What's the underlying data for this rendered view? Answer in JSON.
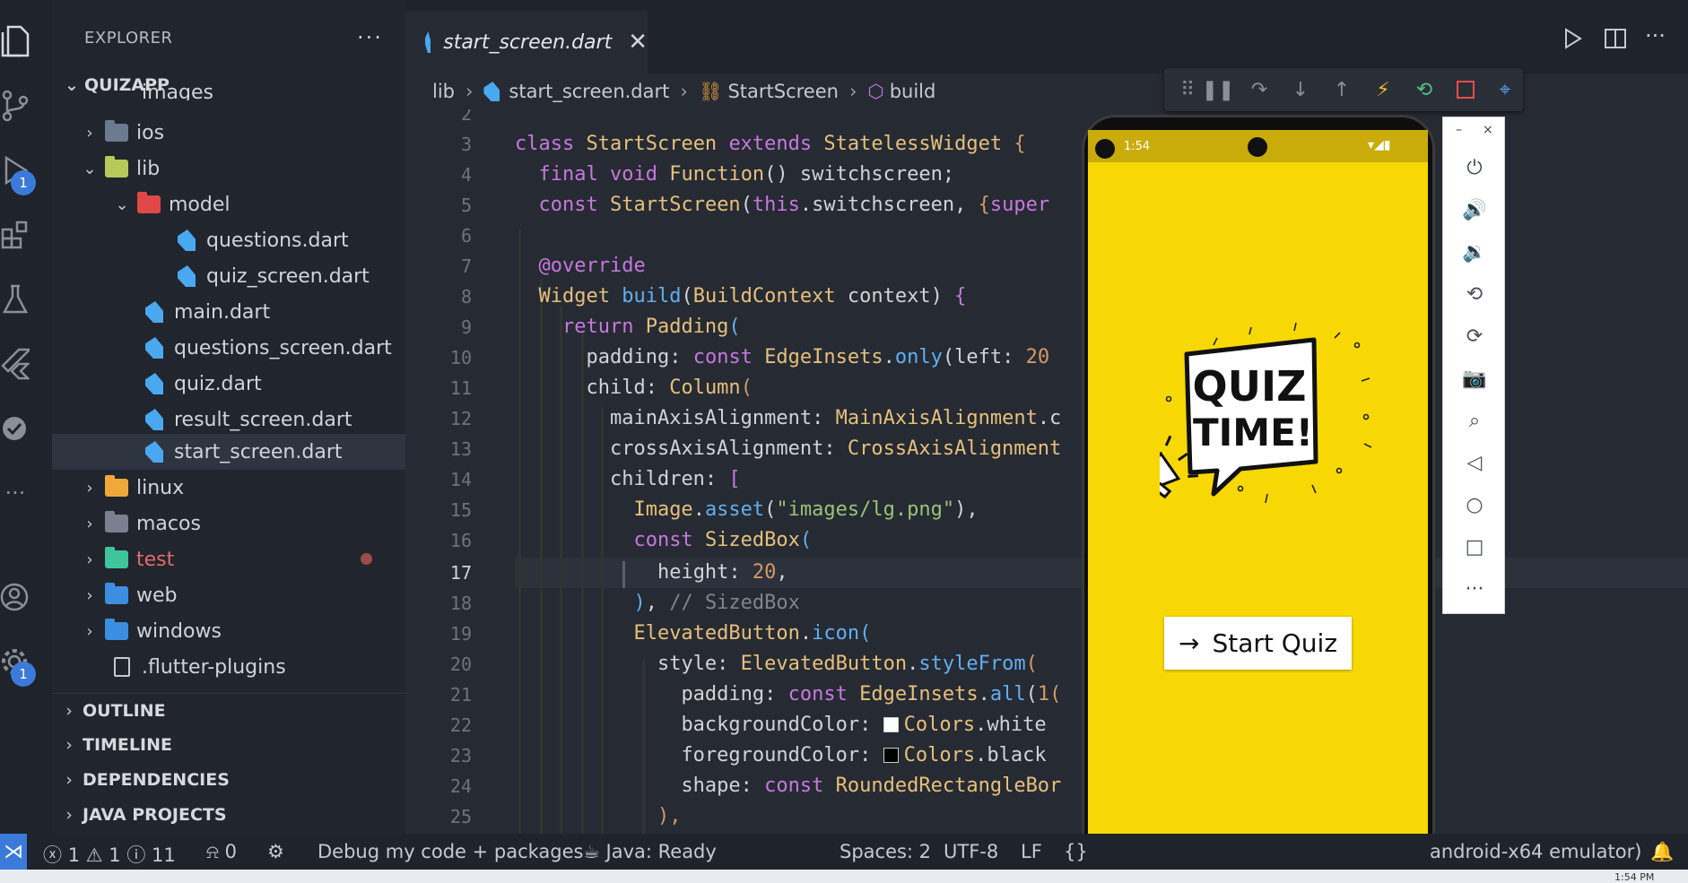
{
  "sidebar": {
    "title": "EXPLORER",
    "more": "···",
    "project": "QUIZAPP",
    "tree": [
      {
        "label": "images",
        "type": "folder-partial"
      },
      {
        "label": "ios"
      },
      {
        "label": "lib"
      },
      {
        "label": "model"
      },
      {
        "label": "questions.dart"
      },
      {
        "label": "quiz_screen.dart"
      },
      {
        "label": "main.dart"
      },
      {
        "label": "questions_screen.dart"
      },
      {
        "label": "quiz.dart"
      },
      {
        "label": "result_screen.dart"
      },
      {
        "label": "start_screen.dart"
      },
      {
        "label": "linux"
      },
      {
        "label": "macos"
      },
      {
        "label": "test"
      },
      {
        "label": "web"
      },
      {
        "label": "windows"
      },
      {
        "label": ".flutter-plugins"
      }
    ],
    "sections": [
      "OUTLINE",
      "TIMELINE",
      "DEPENDENCIES",
      "JAVA PROJECTS"
    ]
  },
  "activity": {
    "badge_run": "1",
    "badge_settings": "1"
  },
  "editor": {
    "tab_label": "start_screen.dart",
    "tab_close": "✕",
    "breadcrumb": {
      "folder": "lib",
      "file": "start_screen.dart",
      "class": "StartScreen",
      "method": "build"
    },
    "line_numbers": [
      "2",
      "3",
      "4",
      "5",
      "6",
      "7",
      "8",
      "9",
      "10",
      "11",
      "12",
      "13",
      "14",
      "15",
      "16",
      "17",
      "18",
      "19",
      "20",
      "21",
      "22",
      "23",
      "24",
      "25"
    ],
    "current_line": "17"
  },
  "emulator": {
    "time": "1:54",
    "status_icons": "▾◢▮",
    "logo_line1": "QUIZ",
    "logo_line2": "TIME!",
    "button_arrow": "→",
    "button_label": "Start Quiz",
    "win_minimize": "–",
    "win_close": "×"
  },
  "statusbar": {
    "errors": "1",
    "warnings": "1",
    "infos": "11",
    "ports": "0",
    "debug": "Debug my code + packages",
    "java": "Java: Ready",
    "spaces": "Spaces: 2",
    "encoding": "UTF-8",
    "eol": "LF",
    "brace": "{}",
    "device": "android-x64 emulator)",
    "clock": "1:54 PM"
  },
  "colors": {
    "accent": "#3b7ad9",
    "phone_bg": "#f7d805",
    "phone_status": "#c9ac0a"
  }
}
